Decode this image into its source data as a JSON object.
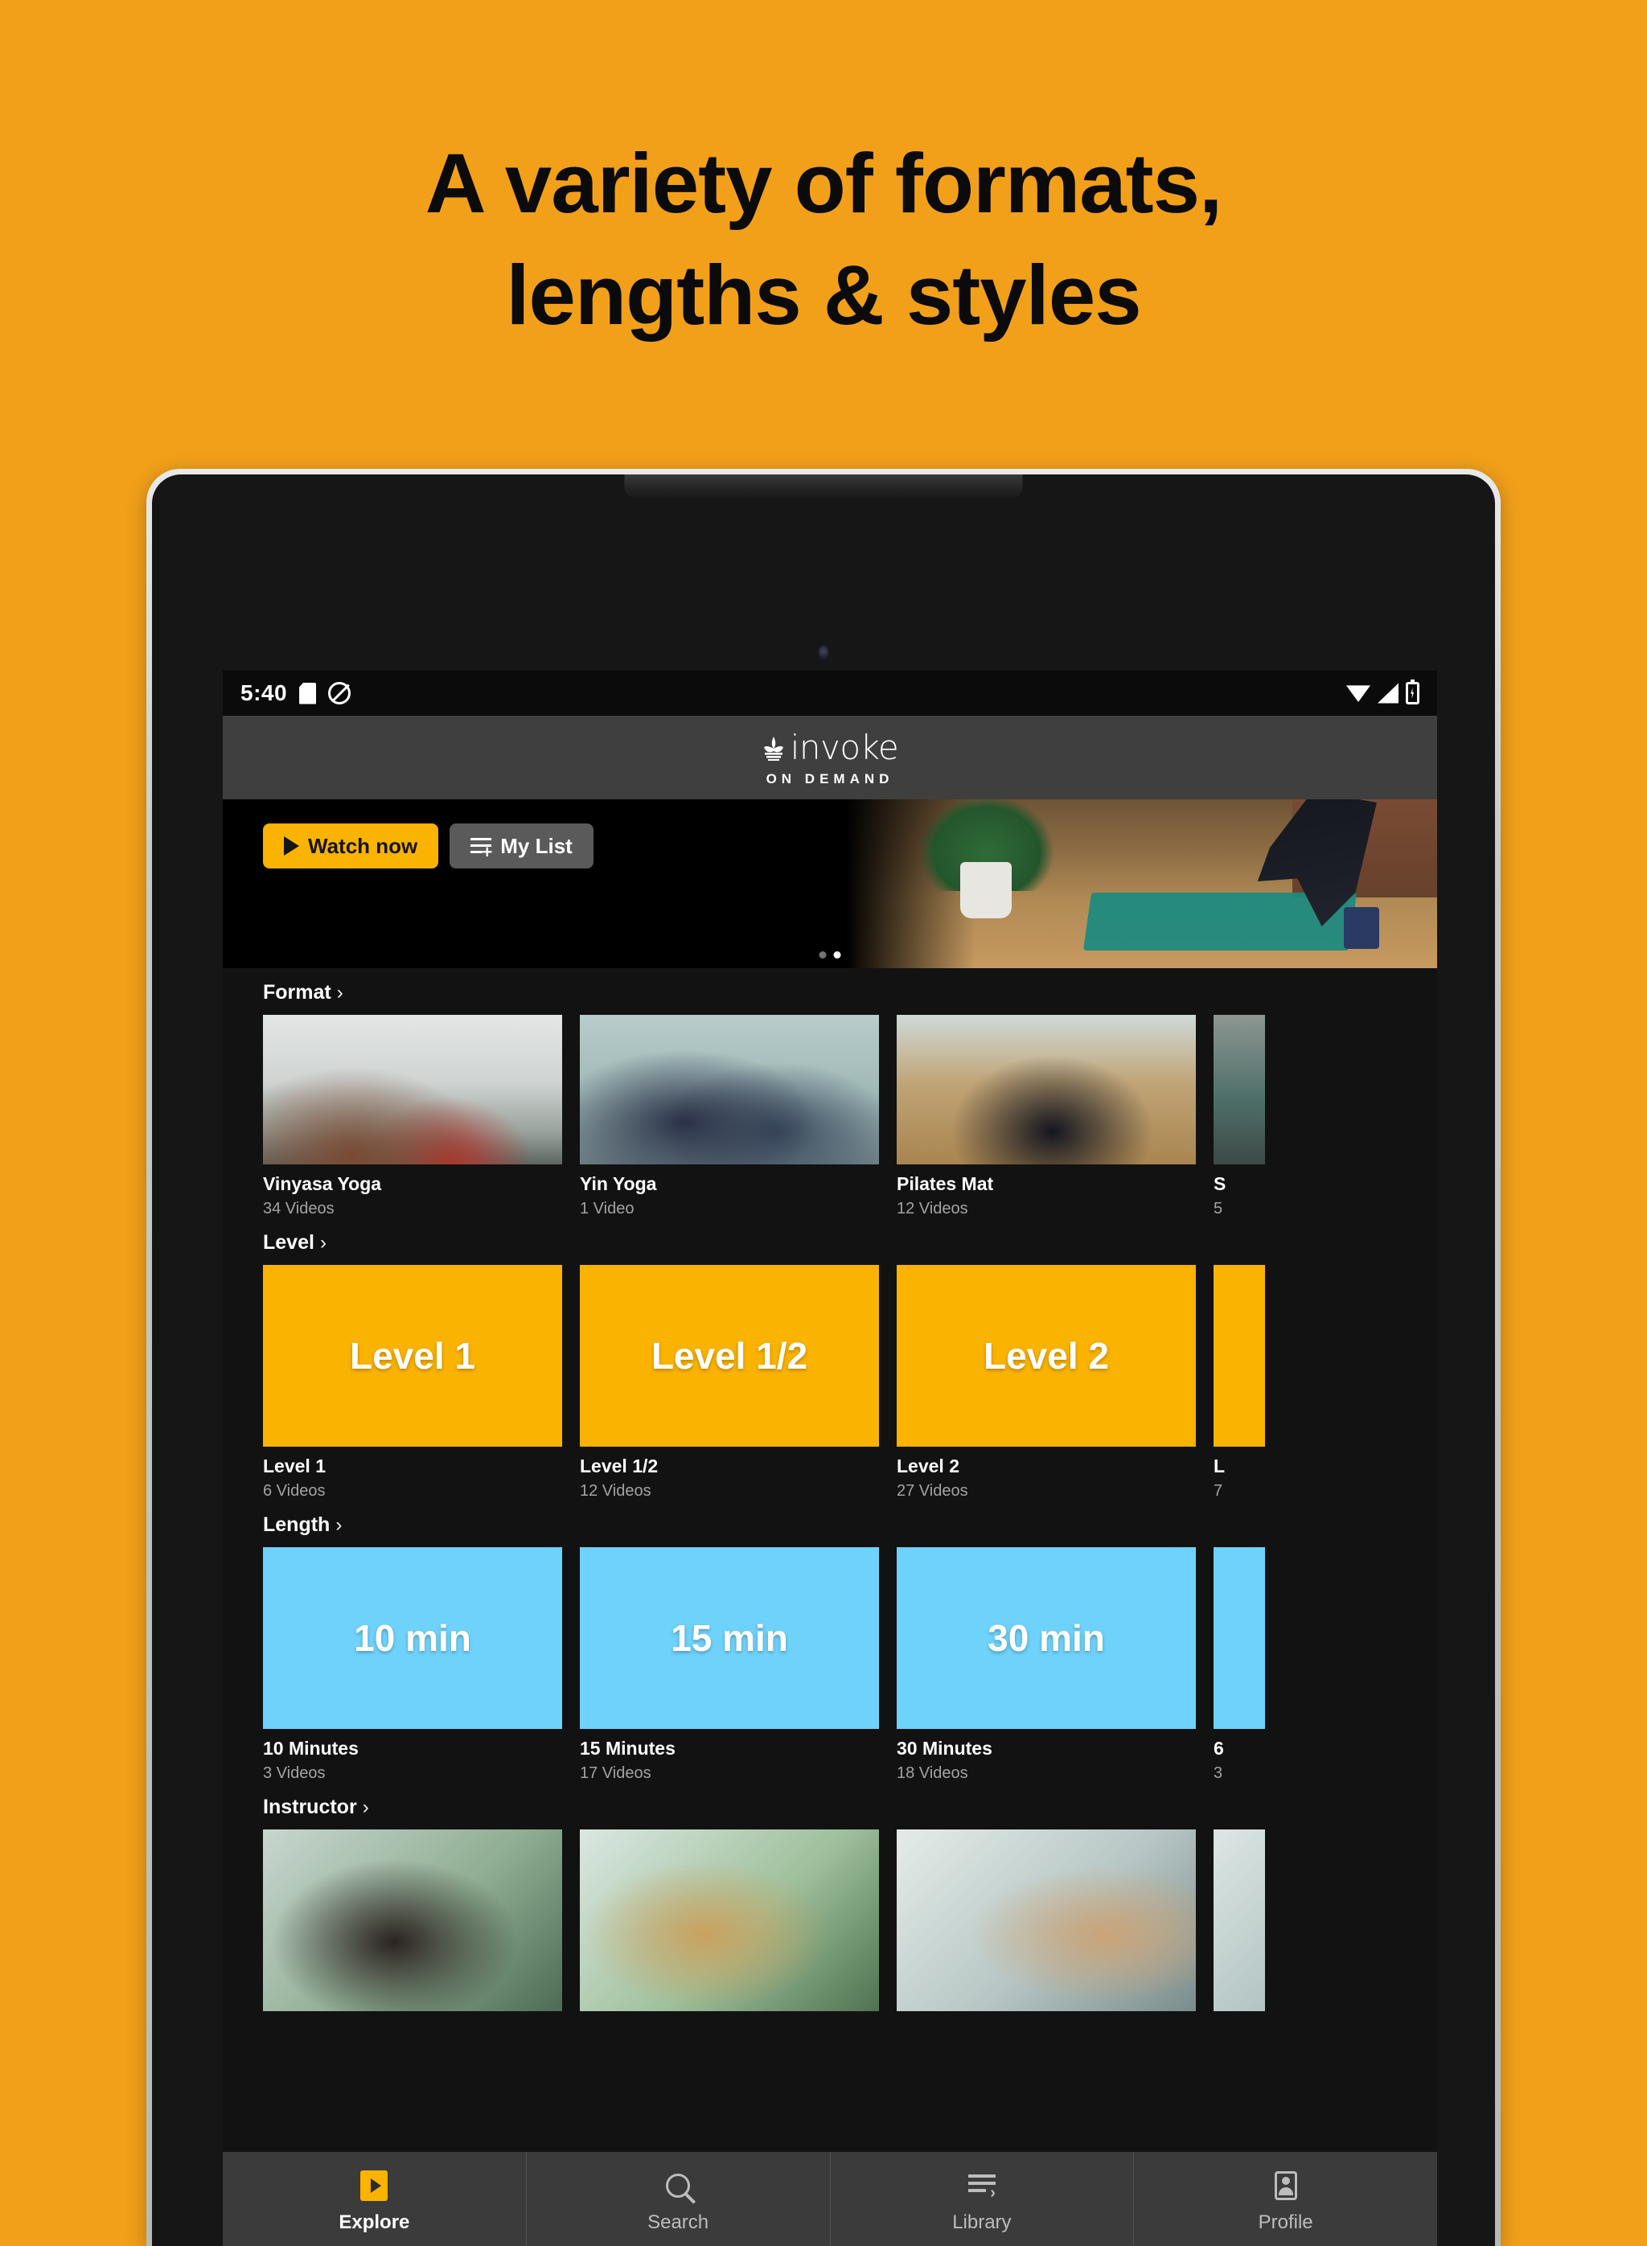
{
  "promo": {
    "headline_line1": "A variety of formats,",
    "headline_line2": "lengths & styles",
    "background_color": "#F2A01A"
  },
  "status_bar": {
    "time": "5:40",
    "left_icons": [
      "sd-card-icon",
      "do-not-disturb-icon"
    ],
    "right_icons": [
      "wifi-icon",
      "cell-signal-icon",
      "battery-charging-icon"
    ]
  },
  "app_header": {
    "brand": "invoke",
    "tagline": "ON DEMAND",
    "logo_icon": "invoke-lotus-icon"
  },
  "hero": {
    "watch_label": "Watch now",
    "watch_icon": "play-icon",
    "mylist_label": "My List",
    "mylist_icon": "add-to-list-icon",
    "dots_total": 2,
    "dots_active_index": 1
  },
  "rows": [
    {
      "title": "Format",
      "chevron": "›",
      "style": "photo",
      "cards": [
        {
          "title": "Vinyasa Yoga",
          "sub": "34 Videos",
          "art": "ph1"
        },
        {
          "title": "Yin Yoga",
          "sub": "1 Video",
          "art": "ph2"
        },
        {
          "title": "Pilates Mat",
          "sub": "12 Videos",
          "art": "ph3"
        }
      ],
      "clipped_card": {
        "title": "S",
        "sub": "5",
        "art": "ph4"
      }
    },
    {
      "title": "Level",
      "chevron": "›",
      "style": "color",
      "color": "#FAB300",
      "cards": [
        {
          "title": "Level 1",
          "sub": "6 Videos",
          "label": "Level 1"
        },
        {
          "title": "Level 1/2",
          "sub": "12 Videos",
          "label": "Level 1/2"
        },
        {
          "title": "Level 2",
          "sub": "27 Videos",
          "label": "Level 2"
        }
      ],
      "clipped_card": {
        "title": "L",
        "sub": "7"
      }
    },
    {
      "title": "Length",
      "chevron": "›",
      "style": "color",
      "color": "#6FD2FA",
      "cards": [
        {
          "title": "10 Minutes",
          "sub": "3 Videos",
          "label": "10 min"
        },
        {
          "title": "15 Minutes",
          "sub": "17 Videos",
          "label": "15 min"
        },
        {
          "title": "30 Minutes",
          "sub": "18 Videos",
          "label": "30 min"
        }
      ],
      "clipped_card": {
        "title": "6",
        "sub": "3"
      }
    },
    {
      "title": "Instructor",
      "chevron": "›",
      "style": "photo",
      "cards": [
        {
          "title": "",
          "sub": "",
          "art": "ph-i1"
        },
        {
          "title": "",
          "sub": "",
          "art": "ph-i2"
        },
        {
          "title": "",
          "sub": "",
          "art": "ph-i3"
        }
      ],
      "clipped_card": {
        "title": "",
        "sub": "",
        "art": "ph-i4"
      }
    }
  ],
  "bottom_nav": {
    "items": [
      {
        "label": "Explore",
        "icon": "explore-play-icon",
        "active": true
      },
      {
        "label": "Search",
        "icon": "search-icon",
        "active": false
      },
      {
        "label": "Library",
        "icon": "library-list-icon",
        "active": false
      },
      {
        "label": "Profile",
        "icon": "profile-card-icon",
        "active": false
      }
    ]
  }
}
